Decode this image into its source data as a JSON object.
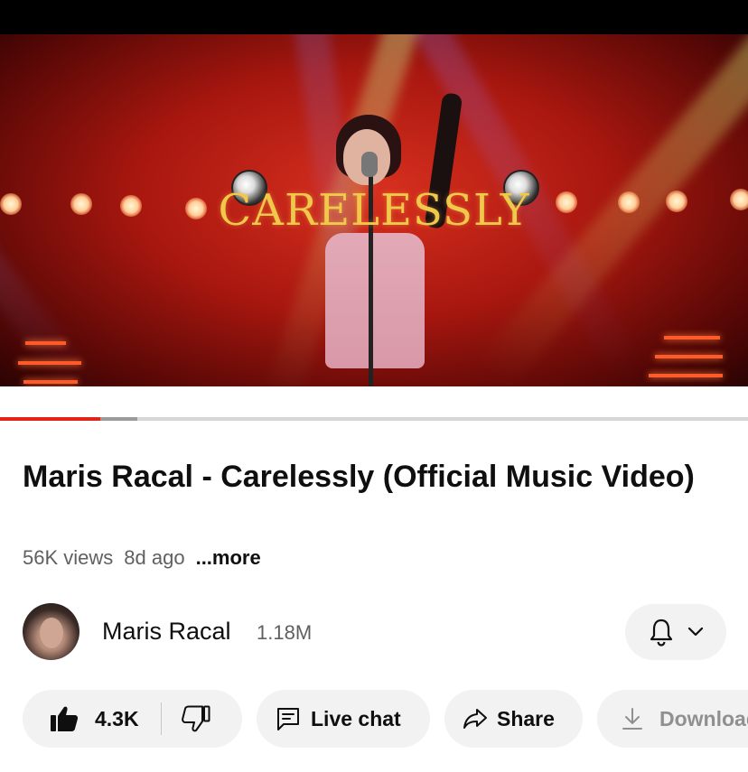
{
  "video": {
    "overlay_text": "CARELESSLY",
    "progress": {
      "played_fraction": 0.134,
      "buffered_fraction": 0.183
    }
  },
  "details": {
    "title": "Maris Racal - Carelessly (Official Music Video)",
    "views": "56K views",
    "age": "8d ago",
    "more_label": "...more"
  },
  "channel": {
    "name": "Maris Racal",
    "subscribers": "1.18M",
    "bell_icon": "bell-icon",
    "chevron_icon": "chevron-down-icon"
  },
  "actions": {
    "like_count": "4.3K",
    "live_chat_label": "Live chat",
    "share_label": "Share",
    "download_label": "Download"
  },
  "colors": {
    "progress_played": "#e62117",
    "pill_background": "#f2f2f2",
    "title_overlay": "#f0c84a"
  }
}
